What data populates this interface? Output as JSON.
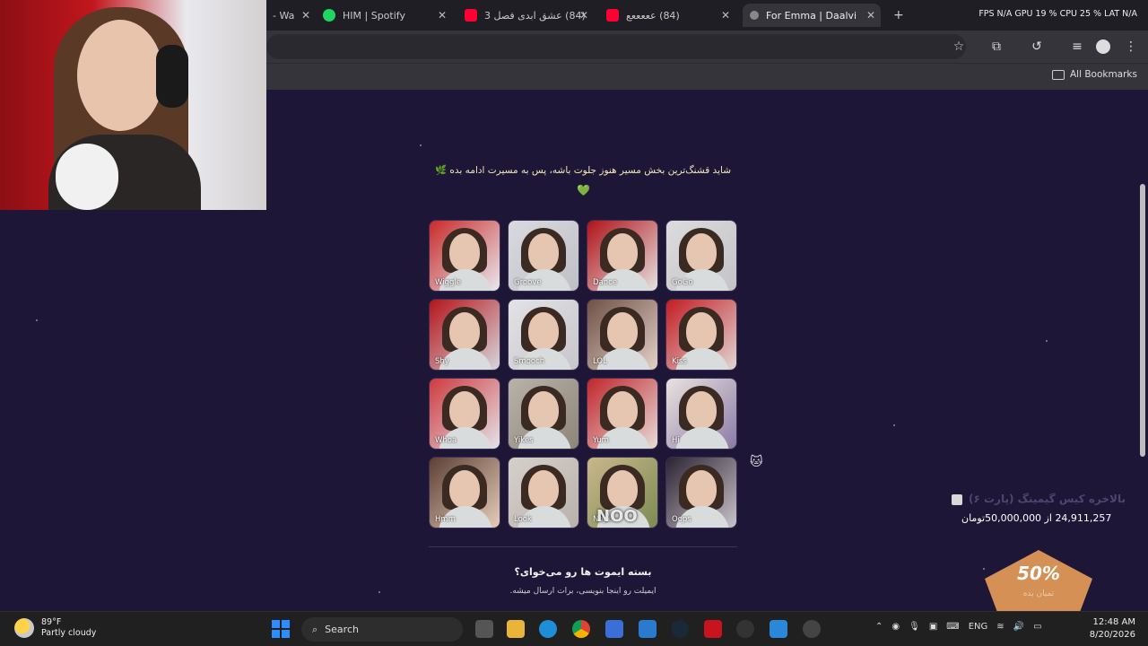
{
  "browser": {
    "tabs": [
      {
        "label": "- Wa",
        "icon": "tab-icon",
        "active": false
      },
      {
        "label": "HIM | Spotify",
        "icon": "spotify-icon",
        "active": false
      },
      {
        "label": "(84) عشق ابدی فصل 3",
        "icon": "youtube-icon",
        "active": false
      },
      {
        "label": "(84) عععععع",
        "icon": "youtube-icon",
        "active": false
      },
      {
        "label": "For Emma | Daalvi",
        "icon": "daalvi-icon",
        "active": true
      }
    ],
    "new_tab": "+",
    "perf_overlay": "FPS N/A GPU 19 % CPU 25 % LAT N/A",
    "bookmarks_label": "All Bookmarks"
  },
  "page": {
    "motto": "شاید قشنگ‌ترین بخش مسیر هنوز جلوت باشه، پس به مسیرت ادامه بده 🌿",
    "heart": "💚",
    "emotes": [
      {
        "label": "Wiggle"
      },
      {
        "label": "Groove"
      },
      {
        "label": "Dance"
      },
      {
        "label": "GoGo"
      },
      {
        "label": "Shy"
      },
      {
        "label": "Smooch"
      },
      {
        "label": "LOL"
      },
      {
        "label": "Kiss"
      },
      {
        "label": "Whoa"
      },
      {
        "label": "Yikes"
      },
      {
        "label": "Yum"
      },
      {
        "label": "Hi"
      },
      {
        "label": "Hmm"
      },
      {
        "label": "Look"
      },
      {
        "label": "Nope"
      },
      {
        "label": "Oops"
      }
    ],
    "nope_overlay": "NOO",
    "pack_title": "بسته ایموت ها رو می‌خوای؟",
    "pack_subtitle": "ایمیلت رو اینجا بنویسی، برات ارسال میشه.",
    "goal": {
      "title": "بالاخره کیس گیمینگ (پارت ۶)",
      "amount": "24,911,257 از 50,000,000تومان",
      "percent_label": "50%",
      "percent_value": 50,
      "percent_sub": "تمیان بده"
    }
  },
  "taskbar": {
    "weather_temp": "89°F",
    "weather_desc": "Partly cloudy",
    "search_label": "Search",
    "lang": "ENG",
    "time": "12:48 AM",
    "date": "8/20/2026"
  },
  "colors": {
    "page_bg": "#1e1636",
    "accent_green": "#3ecf6e",
    "goal_orange": "#f5a65b",
    "windows_blue": "#2d8cff"
  }
}
